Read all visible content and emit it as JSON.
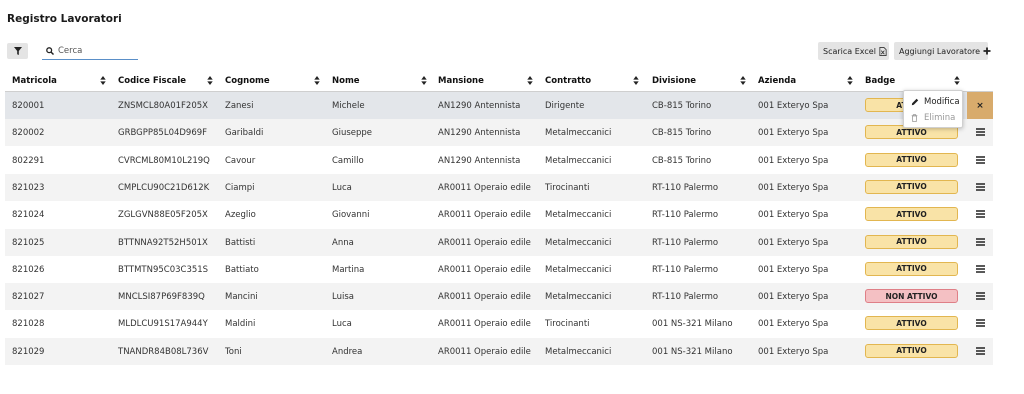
{
  "page": {
    "title": "Registro Lavoratori"
  },
  "toolbar": {
    "search_placeholder": "Cerca",
    "export_label": "Scarica Excel",
    "add_label": "Aggiungi Lavoratore"
  },
  "table": {
    "headers": [
      "Matricola",
      "Codice Fiscale",
      "Cognome",
      "Nome",
      "Mansione",
      "Contratto",
      "Divisione",
      "Azienda",
      "Badge"
    ],
    "rows": [
      {
        "matricola": "820001",
        "cf": "ZNSMCL80A01F205X",
        "cognome": "Zanesi",
        "nome": "Michele",
        "mansione": "AN1290 Antennista",
        "contratto": "Dirigente",
        "divisione": "CB-815 Torino",
        "azienda": "001 Exteryo Spa",
        "badge": "ATTIVO",
        "badge_status": "active",
        "selected": true
      },
      {
        "matricola": "820002",
        "cf": "GRBGPP85L04D969F",
        "cognome": "Garibaldi",
        "nome": "Giuseppe",
        "mansione": "AN1290 Antennista",
        "contratto": "Metalmeccanici",
        "divisione": "CB-815 Torino",
        "azienda": "001 Exteryo Spa",
        "badge": "ATTIVO",
        "badge_status": "active"
      },
      {
        "matricola": "802291",
        "cf": "CVRCML80M10L219Q",
        "cognome": "Cavour",
        "nome": "Camillo",
        "mansione": "AN1290 Antennista",
        "contratto": "Metalmeccanici",
        "divisione": "CB-815 Torino",
        "azienda": "001 Exteryo Spa",
        "badge": "ATTIVO",
        "badge_status": "active"
      },
      {
        "matricola": "821023",
        "cf": "CMPLCU90C21D612K",
        "cognome": "Ciampi",
        "nome": "Luca",
        "mansione": "AR0011 Operaio edile",
        "contratto": "Tirocinanti",
        "divisione": "RT-110 Palermo",
        "azienda": "001 Exteryo Spa",
        "badge": "ATTIVO",
        "badge_status": "active"
      },
      {
        "matricola": "821024",
        "cf": "ZGLGVN88E05F205X",
        "cognome": "Azeglio",
        "nome": "Giovanni",
        "mansione": "AR0011 Operaio edile",
        "contratto": "Metalmeccanici",
        "divisione": "RT-110 Palermo",
        "azienda": "001 Exteryo Spa",
        "badge": "ATTIVO",
        "badge_status": "active"
      },
      {
        "matricola": "821025",
        "cf": "BTTNNA92T52H501X",
        "cognome": "Battisti",
        "nome": "Anna",
        "mansione": "AR0011 Operaio edile",
        "contratto": "Metalmeccanici",
        "divisione": "RT-110 Palermo",
        "azienda": "001 Exteryo Spa",
        "badge": "ATTIVO",
        "badge_status": "active"
      },
      {
        "matricola": "821026",
        "cf": "BTTMTN95C03C351S",
        "cognome": "Battiato",
        "nome": "Martina",
        "mansione": "AR0011 Operaio edile",
        "contratto": "Metalmeccanici",
        "divisione": "RT-110 Palermo",
        "azienda": "001 Exteryo Spa",
        "badge": "ATTIVO",
        "badge_status": "active"
      },
      {
        "matricola": "821027",
        "cf": "MNCLSI87P69F839Q",
        "cognome": "Mancini",
        "nome": "Luisa",
        "mansione": "AR0011 Operaio edile",
        "contratto": "Metalmeccanici",
        "divisione": "RT-110 Palermo",
        "azienda": "001 Exteryo Spa",
        "badge": "NON ATTIVO",
        "badge_status": "inactive"
      },
      {
        "matricola": "821028",
        "cf": "MLDLCU91S17A944Y",
        "cognome": "Maldini",
        "nome": "Luca",
        "mansione": "AR0011 Operaio edile",
        "contratto": "Tirocinanti",
        "divisione": "001 NS-321 Milano",
        "azienda": "001 Exteryo Spa",
        "badge": "ATTIVO",
        "badge_status": "active"
      },
      {
        "matricola": "821029",
        "cf": "TNANDR84B08L736V",
        "cognome": "Toni",
        "nome": "Andrea",
        "mansione": "AR0011 Operaio edile",
        "contratto": "Metalmeccanici",
        "divisione": "001 NS-321 Milano",
        "azienda": "001 Exteryo Spa",
        "badge": "ATTIVO",
        "badge_status": "active"
      }
    ]
  },
  "row_menu": {
    "items": [
      {
        "label": "Modifica",
        "icon": "pencil-icon",
        "enabled": true
      },
      {
        "label": "Elimina",
        "icon": "trash-icon",
        "enabled": false
      }
    ]
  },
  "colors": {
    "badge_active_bg": "#f9e3a7",
    "badge_inactive_bg": "#f4c0c3",
    "selected_row_action": "#d8ab6c",
    "search_underline": "#5a8fc8"
  }
}
